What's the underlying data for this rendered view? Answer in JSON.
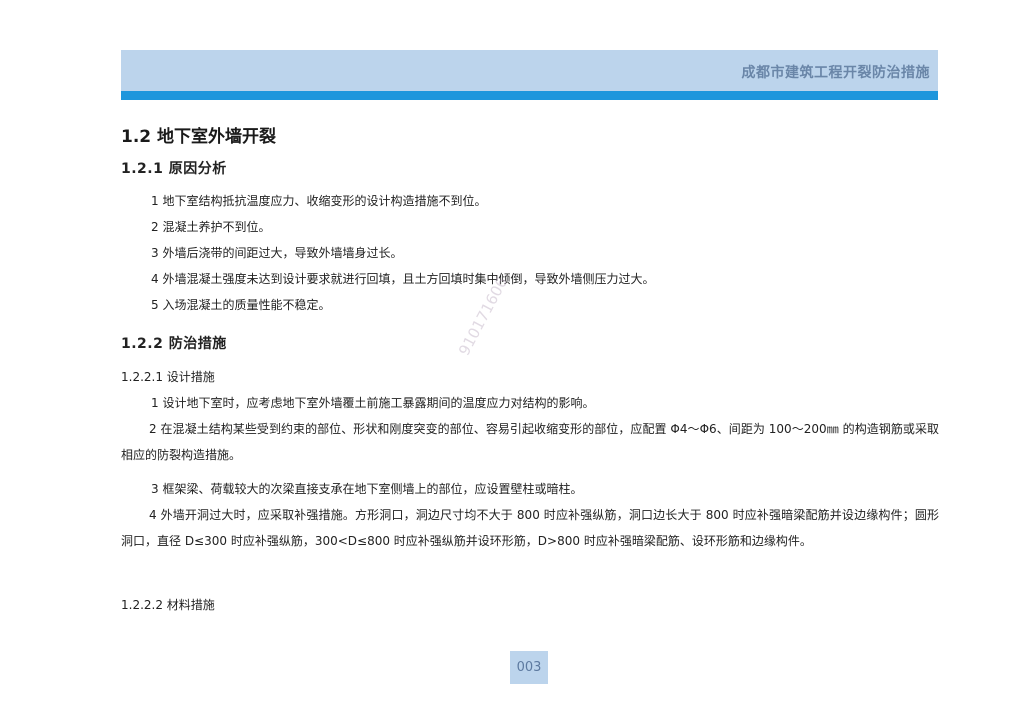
{
  "header": {
    "title": "成都市建筑工程开裂防治措施"
  },
  "section": {
    "title": "1.2 地下室外墙开裂",
    "sub1": {
      "title": "1.2.1 原因分析",
      "items": [
        "1 地下室结构抵抗温度应力、收缩变形的设计构造措施不到位。",
        "2 混凝土养护不到位。",
        "3 外墙后浇带的间距过大，导致外墙墙身过长。",
        "4 外墙混凝土强度未达到设计要求就进行回填，且土方回填时集中倾倒，导致外墙侧压力过大。",
        "5 入场混凝土的质量性能不稳定。"
      ]
    },
    "sub2": {
      "title": "1.2.2 防治措施",
      "design": {
        "title": "1.2.2.1 设计措施",
        "items": [
          "1 设计地下室时，应考虑地下室外墙覆土前施工暴露期间的温度应力对结构的影响。",
          "2 在混凝土结构某些受到约束的部位、形状和刚度突变的部位、容易引起收缩变形的部位，应配置 Φ4～Φ6、间距为 100～200㎜ 的构造钢筋或采取相应的防裂构造措施。",
          "3 框架梁、荷载较大的次梁直接支承在地下室侧墙上的部位，应设置壁柱或暗柱。",
          "4 外墙开洞过大时，应采取补强措施。方形洞口，洞边尺寸均不大于 800 时应补强纵筋，洞口边长大于 800 时应补强暗梁配筋并设边缘构件；圆形洞口，直径 D≤300 时应补强纵筋，300<D≤800 时应补强纵筋并设环形筋，D>800 时应补强暗梁配筋、设环形筋和边缘构件。"
        ]
      },
      "material": {
        "title": "1.2.2.2 材料措施"
      }
    }
  },
  "watermark": "910171606",
  "page_number": "003"
}
